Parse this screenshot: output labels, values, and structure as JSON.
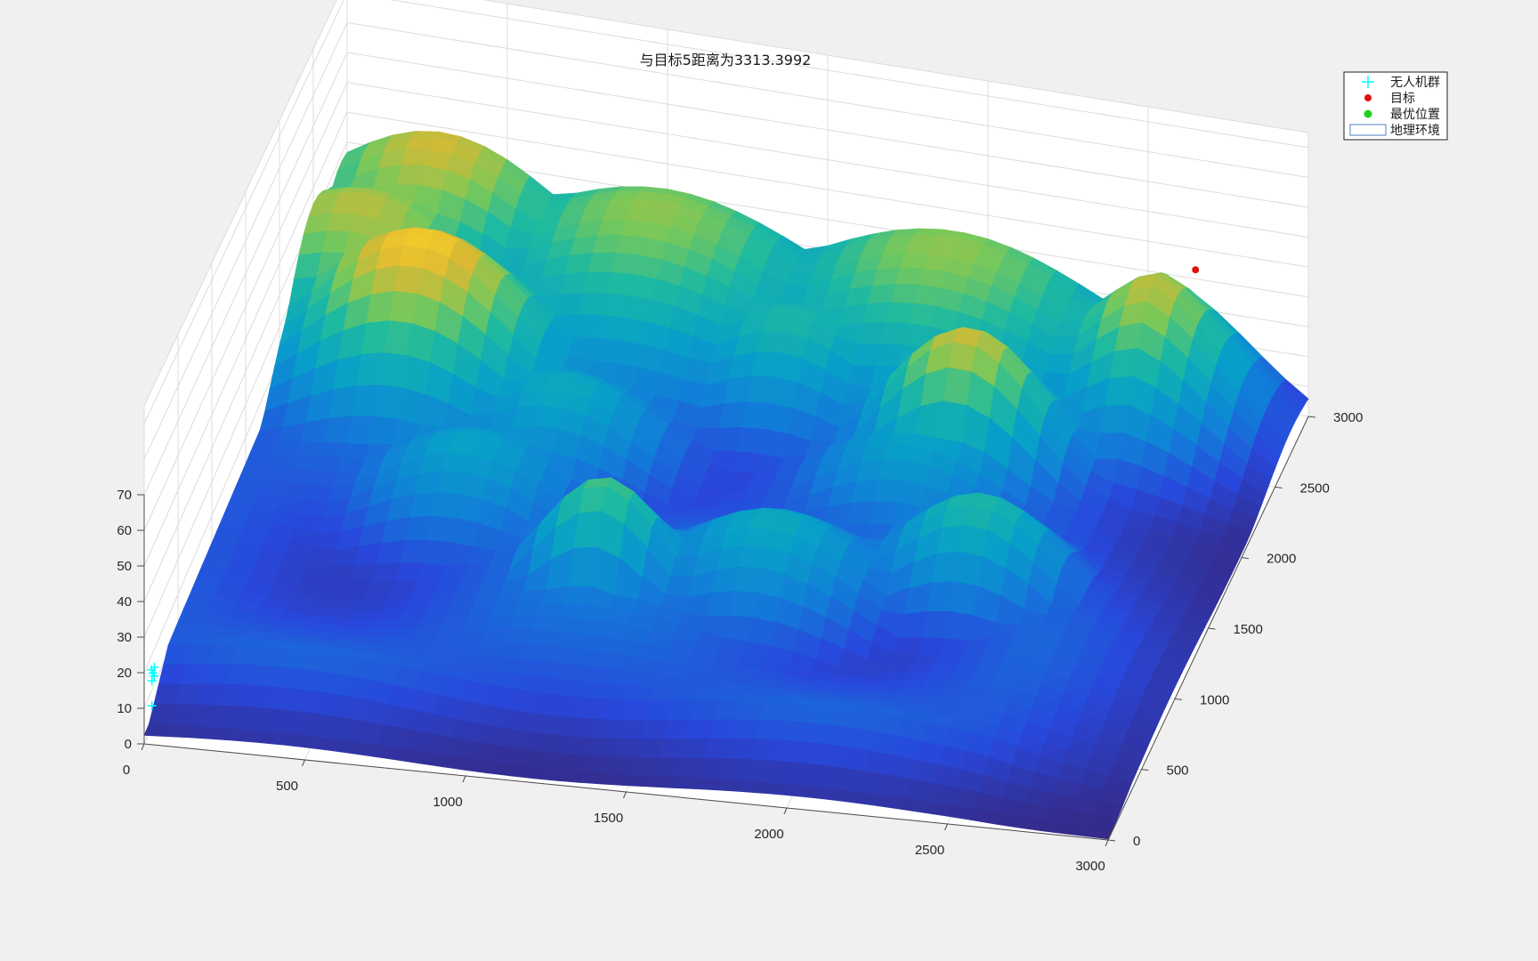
{
  "chart_data": {
    "type": "surface",
    "title": "与目标5距离为3313.3992",
    "xlabel": "",
    "ylabel": "",
    "zlabel": "",
    "xlim": [
      0,
      3000
    ],
    "ylim": [
      0,
      3000
    ],
    "zlim": [
      0,
      70
    ],
    "x_ticks": [
      "0",
      "500",
      "1000",
      "1500",
      "2000",
      "2500",
      "3000"
    ],
    "y_ticks": [
      "0",
      "500",
      "1000",
      "1500",
      "2000",
      "2500",
      "3000"
    ],
    "z_ticks": [
      "0",
      "10",
      "20",
      "30",
      "40",
      "50",
      "60",
      "70"
    ],
    "grid": true,
    "colormap": "parula",
    "legend": {
      "placement": "top-right",
      "entries": [
        {
          "label": "无人机群",
          "marker": "+",
          "color": "#00ffff"
        },
        {
          "label": "目标",
          "marker": "dot",
          "color": "#e01010"
        },
        {
          "label": "最优位置",
          "marker": "dot",
          "color": "#20d020"
        },
        {
          "label": "地理环境",
          "marker": "box",
          "color": "#4f7fbf"
        }
      ]
    },
    "target": {
      "x": 2700,
      "y": 2750,
      "z": 55
    },
    "swarm": [
      {
        "x": 20,
        "y": 20,
        "z": 10
      },
      {
        "x": 20,
        "y": 20,
        "z": 17
      },
      {
        "x": 25,
        "y": 30,
        "z": 18
      },
      {
        "x": 22,
        "y": 25,
        "z": 19
      },
      {
        "x": 18,
        "y": 22,
        "z": 20
      },
      {
        "x": 28,
        "y": 18,
        "z": 21
      }
    ],
    "terrain_peaks": [
      {
        "x": 400,
        "y": 2200,
        "h": 55,
        "s": 350
      },
      {
        "x": 150,
        "y": 2500,
        "h": 48,
        "s": 400
      },
      {
        "x": 300,
        "y": 2900,
        "h": 50,
        "s": 400
      },
      {
        "x": 1000,
        "y": 2800,
        "h": 45,
        "s": 500
      },
      {
        "x": 1900,
        "y": 2850,
        "h": 45,
        "s": 500
      },
      {
        "x": 2700,
        "y": 2750,
        "h": 55,
        "s": 350
      },
      {
        "x": 2100,
        "y": 2200,
        "h": 50,
        "s": 250
      },
      {
        "x": 1500,
        "y": 2450,
        "h": 35,
        "s": 300
      },
      {
        "x": 1200,
        "y": 1100,
        "h": 40,
        "s": 200
      },
      {
        "x": 2300,
        "y": 1400,
        "h": 35,
        "s": 250
      },
      {
        "x": 1700,
        "y": 1200,
        "h": 30,
        "s": 300
      },
      {
        "x": 900,
        "y": 1900,
        "h": 30,
        "s": 300
      },
      {
        "x": 2000,
        "y": 1900,
        "h": 28,
        "s": 300
      },
      {
        "x": 700,
        "y": 1500,
        "h": 28,
        "s": 300
      }
    ]
  }
}
